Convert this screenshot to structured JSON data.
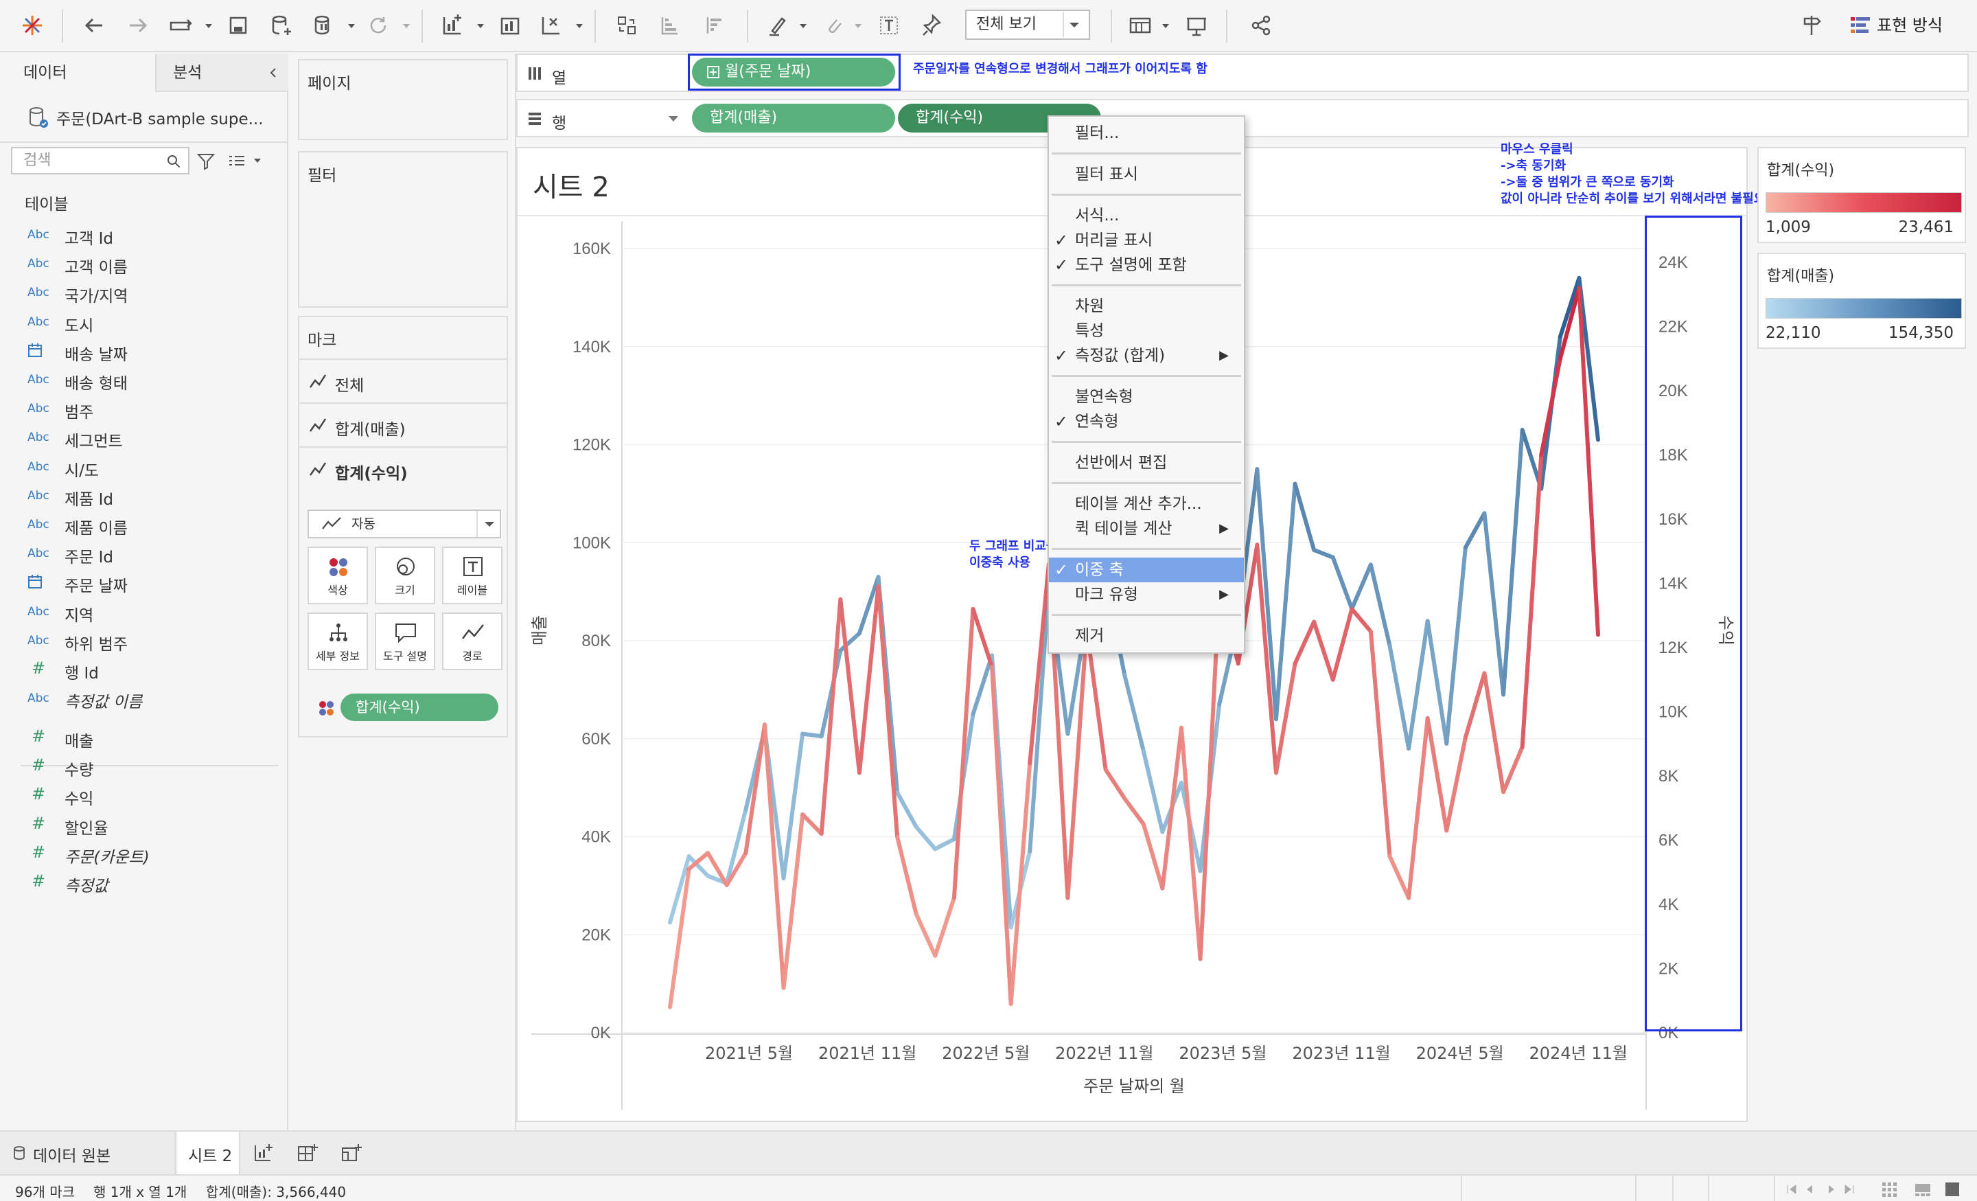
{
  "toolbar": {
    "view_select": "전체 보기",
    "show_me_label": "표현 방식"
  },
  "data_pane": {
    "tabs": [
      "데이터",
      "분석"
    ],
    "datasource": "주문(DArt-B sample supe...",
    "search_placeholder": "검색",
    "tables_title": "테이블",
    "fields": [
      {
        "icon": "Abc",
        "label": "고객 Id"
      },
      {
        "icon": "Abc",
        "label": "고객 이름"
      },
      {
        "icon": "Abc",
        "label": "국가/지역"
      },
      {
        "icon": "Abc",
        "label": "도시"
      },
      {
        "icon": "calendar-icon",
        "label": "배송 날짜"
      },
      {
        "icon": "Abc",
        "label": "배송 형태"
      },
      {
        "icon": "Abc",
        "label": "범주"
      },
      {
        "icon": "Abc",
        "label": "세그먼트"
      },
      {
        "icon": "Abc",
        "label": "시/도"
      },
      {
        "icon": "Abc",
        "label": "제품 Id"
      },
      {
        "icon": "Abc",
        "label": "제품 이름"
      },
      {
        "icon": "Abc",
        "label": "주문 Id"
      },
      {
        "icon": "calendar-icon",
        "label": "주문 날짜"
      },
      {
        "icon": "Abc",
        "label": "지역"
      },
      {
        "icon": "Abc",
        "label": "하위 범주"
      },
      {
        "icon": "#",
        "label": "행 Id"
      },
      {
        "icon": "Abc",
        "label": "측정값 이름"
      }
    ],
    "measures": [
      {
        "icon": "#",
        "label": "매출"
      },
      {
        "icon": "#",
        "label": "수량"
      },
      {
        "icon": "#",
        "label": "수익"
      },
      {
        "icon": "#",
        "label": "할인율"
      },
      {
        "icon": "#",
        "label": "주문(카운트)"
      },
      {
        "icon": "#",
        "label": "측정값"
      }
    ]
  },
  "cards": {
    "pages": "페이지",
    "filters": "필터",
    "marks": "마크",
    "mark_tabs": [
      "전체",
      "합계(매출)",
      "합계(수익)"
    ],
    "mark_type": "자동",
    "buttons": [
      "색상",
      "크기",
      "레이블",
      "세부 정보",
      "도구 설명",
      "경로"
    ],
    "mark_pill": "합계(수익)"
  },
  "shelves": {
    "columns_label": "열",
    "rows_label": "행",
    "column_pill": "월(주문 날짜)",
    "row_pills": [
      "합계(매출)",
      "합계(수익)"
    ],
    "note_columns": "주문일자를 연속형으로 변경해서 그래프가 이어지도록 함"
  },
  "annotations": {
    "right_note": [
      "마우스 우클릭",
      "->축 동기화",
      "->둘 중 범위가 큰 쪽으로 동기화",
      "값이 아니라 단순히 추이를 보기 위해서라면 불필요"
    ],
    "dual_axis_note": [
      "두 그래프 비교를 위해",
      "이중축 사용"
    ]
  },
  "sheet": {
    "title": "시트 2",
    "left_axis_title": "매출",
    "right_axis_title": "수익",
    "x_axis_title": "주문 날짜의 월"
  },
  "legends": {
    "profit": {
      "title": "합계(수익)",
      "min": "1,009",
      "max": "23,461"
    },
    "sales": {
      "title": "합계(매출)",
      "min": "22,110",
      "max": "154,350"
    }
  },
  "context_menu": {
    "items": [
      {
        "label": "필터...",
        "checked": false,
        "submenu": false
      },
      {
        "label": "필터 표시",
        "checked": false,
        "submenu": false
      },
      {
        "label": "서식...",
        "checked": false,
        "submenu": false
      },
      {
        "label": "머리글 표시",
        "checked": true,
        "submenu": false
      },
      {
        "label": "도구 설명에 포함",
        "checked": true,
        "submenu": false
      },
      {
        "label": "차원",
        "checked": false,
        "submenu": false
      },
      {
        "label": "특성",
        "checked": false,
        "submenu": false
      },
      {
        "label": "측정값 (합계)",
        "checked": true,
        "submenu": true
      },
      {
        "label": "불연속형",
        "checked": false,
        "submenu": false
      },
      {
        "label": "연속형",
        "checked": true,
        "submenu": false
      },
      {
        "label": "선반에서 편집",
        "checked": false,
        "submenu": false
      },
      {
        "label": "테이블 계산 추가...",
        "checked": false,
        "submenu": false
      },
      {
        "label": "퀵 테이블 계산",
        "checked": false,
        "submenu": true
      },
      {
        "label": "이중 축",
        "checked": true,
        "submenu": false,
        "highlighted": true
      },
      {
        "label": "마크 유형",
        "checked": false,
        "submenu": true
      },
      {
        "label": "제거",
        "checked": false,
        "submenu": false
      }
    ]
  },
  "bottom": {
    "datasource_tab": "데이터 원본",
    "sheet_tab": "시트 2",
    "status": [
      "96개 마크",
      "행 1개 x 열 1개",
      "합계(매출): 3,566,440"
    ]
  },
  "colors": {
    "pill_green": "#5ab07c",
    "annotation_blue": "#2130e0",
    "sales_light": "#a8d0e8",
    "sales_dark": "#2b5c8f",
    "profit_light": "#f6a99a",
    "profit_dark": "#c8233c",
    "menu_highlight": "#7aa3e8"
  },
  "chart_data": {
    "type": "line",
    "x_ticks": [
      "2021년 5월",
      "2021년 11월",
      "2022년 5월",
      "2022년 11월",
      "2023년 5월",
      "2023년 11월",
      "2024년 5월",
      "2024년 11월"
    ],
    "x_range": [
      "2021-01",
      "2024-12"
    ],
    "xlabel": "주문 날짜의 월",
    "left_axis": {
      "label": "매출",
      "range": [
        0,
        160000
      ],
      "ticks": [
        "0K",
        "20K",
        "40K",
        "60K",
        "80K",
        "100K",
        "120K",
        "140K",
        "160K"
      ]
    },
    "right_axis": {
      "label": "수익",
      "range": [
        0,
        24000
      ],
      "ticks": [
        "0K",
        "2K",
        "4K",
        "6K",
        "8K",
        "10K",
        "12K",
        "14K",
        "16K",
        "18K",
        "20K",
        "22K",
        "24K"
      ]
    },
    "series": [
      {
        "name": "합계(매출)",
        "axis": "left",
        "values": [
          22500,
          36000,
          32000,
          30500,
          45500,
          62000,
          31500,
          61000,
          60500,
          78000,
          81500,
          93000,
          49000,
          42000,
          37500,
          39500,
          65000,
          77000,
          21500,
          37000,
          91000,
          61000,
          85000,
          92500,
          73000,
          57500,
          41000,
          51000,
          33000,
          67000,
          84000,
          115000,
          64000,
          112000,
          98500,
          97000,
          86500,
          95500,
          79000,
          58000,
          84000,
          59000,
          99000,
          106000,
          69000,
          123000,
          111000,
          142000,
          154000,
          121000
        ]
      },
      {
        "name": "합계(수익)",
        "axis": "right",
        "values": [
          800,
          5100,
          5600,
          4600,
          5600,
          9600,
          1400,
          6800,
          6200,
          13500,
          8100,
          13900,
          6100,
          3700,
          2400,
          4200,
          13200,
          11400,
          900,
          8400,
          14600,
          4200,
          12600,
          8200,
          7300,
          6500,
          4500,
          9500,
          2300,
          13800,
          11500,
          15200,
          8100,
          11500,
          12800,
          11000,
          13200,
          12500,
          5500,
          4200,
          9800,
          6300,
          9200,
          11200,
          7500,
          8900,
          18000,
          21000,
          23200,
          12400
        ]
      }
    ]
  }
}
